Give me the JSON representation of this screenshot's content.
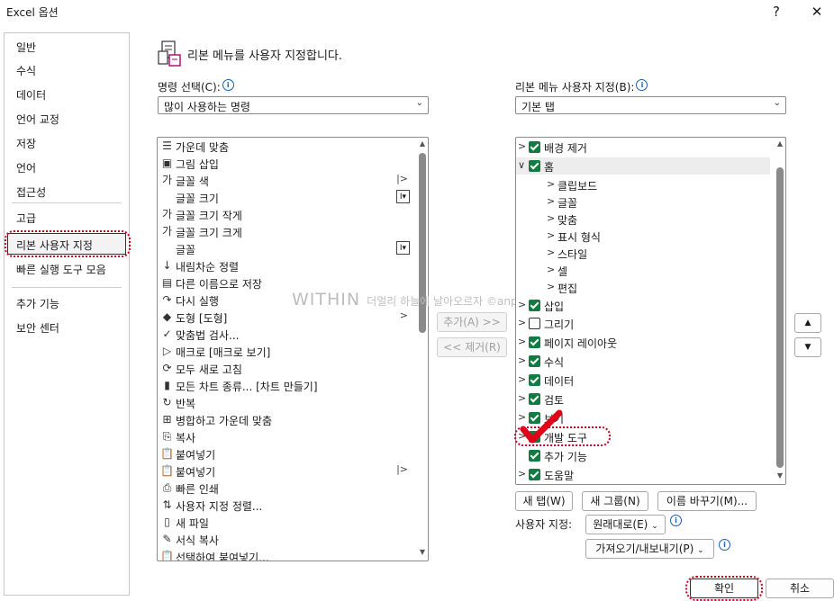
{
  "window": {
    "title": "Excel 옵션",
    "help_glyph": "?",
    "close_glyph": "✕"
  },
  "categories": [
    {
      "label": "일반"
    },
    {
      "label": "수식"
    },
    {
      "label": "데이터"
    },
    {
      "label": "언어 교정"
    },
    {
      "label": "저장"
    },
    {
      "label": "언어"
    },
    {
      "label": "접근성"
    },
    {
      "label": "고급"
    },
    {
      "label": "리본 사용자 지정"
    },
    {
      "label": "빠른 실행 도구 모음"
    },
    {
      "label": "추가 기능"
    },
    {
      "label": "보안 센터"
    }
  ],
  "heading": "리본 메뉴를 사용자 지정합니다.",
  "left": {
    "label": "명령 선택(C):",
    "dropdown_value": "많이 사용하는 명령",
    "commands": [
      {
        "icon": "☰",
        "label": "가운데 맞춤"
      },
      {
        "icon": "▣",
        "label": "그림 삽입"
      },
      {
        "icon": "가",
        "label": "글꼴 색",
        "sub": "|>"
      },
      {
        "icon": "",
        "label": "글꼴 크기",
        "box": "I▾"
      },
      {
        "icon": "가",
        "label": "글꼴 크기 작게"
      },
      {
        "icon": "가",
        "label": "글꼴 크기 크게"
      },
      {
        "icon": "",
        "label": "글꼴",
        "box": "I▾"
      },
      {
        "icon": "↓",
        "label": "내림차순 정렬"
      },
      {
        "icon": "▤",
        "label": "다른 이름으로 저장"
      },
      {
        "icon": "↷",
        "label": "다시 실행"
      },
      {
        "icon": "◆",
        "label": "도형 [도형]",
        "sub": ">"
      },
      {
        "icon": "✓",
        "label": "맞춤법 검사..."
      },
      {
        "icon": "▷",
        "label": "매크로 [매크로 보기]"
      },
      {
        "icon": "⟳",
        "label": "모두 새로 고침"
      },
      {
        "icon": "▮",
        "label": "모든 차트 종류... [차트 만들기]"
      },
      {
        "icon": "↻",
        "label": "반복"
      },
      {
        "icon": "⊞",
        "label": "병합하고 가운데 맞춤"
      },
      {
        "icon": "⎘",
        "label": "복사"
      },
      {
        "icon": "📋",
        "label": "붙여넣기"
      },
      {
        "icon": "📋",
        "label": "붙여넣기",
        "sub": "|>"
      },
      {
        "icon": "⎙",
        "label": "빠른 인쇄"
      },
      {
        "icon": "⇅",
        "label": "사용자 지정 정렬..."
      },
      {
        "icon": "▯",
        "label": "새 파일"
      },
      {
        "icon": "✎",
        "label": "서식 복사"
      },
      {
        "icon": "📋",
        "label": "선택하여 붙여넣기..."
      }
    ]
  },
  "middle": {
    "add_label": "추가(A) >>",
    "remove_label": "<< 제거(R)"
  },
  "right": {
    "label": "리본 메뉴 사용자 지정(B):",
    "dropdown_value": "기본 탭",
    "tabs": [
      {
        "chev": ">",
        "checked": true,
        "label": "배경 제거",
        "level": 0
      },
      {
        "chev": "∨",
        "checked": true,
        "label": "홈",
        "level": 0,
        "selected": true
      },
      {
        "chev": ">",
        "label": "클립보드",
        "level": 1
      },
      {
        "chev": ">",
        "label": "글꼴",
        "level": 1
      },
      {
        "chev": ">",
        "label": "맞춤",
        "level": 1
      },
      {
        "chev": ">",
        "label": "표시 형식",
        "level": 1
      },
      {
        "chev": ">",
        "label": "스타일",
        "level": 1
      },
      {
        "chev": ">",
        "label": "셀",
        "level": 1
      },
      {
        "chev": ">",
        "label": "편집",
        "level": 1
      },
      {
        "chev": ">",
        "checked": true,
        "label": "삽입",
        "level": 0
      },
      {
        "chev": ">",
        "checked": false,
        "label": "그리기",
        "level": 0
      },
      {
        "chev": ">",
        "checked": true,
        "label": "페이지 레이아웃",
        "level": 0
      },
      {
        "chev": ">",
        "checked": true,
        "label": "수식",
        "level": 0
      },
      {
        "chev": ">",
        "checked": true,
        "label": "데이터",
        "level": 0
      },
      {
        "chev": ">",
        "checked": true,
        "label": "검토",
        "level": 0
      },
      {
        "chev": ">",
        "checked": true,
        "label": "보기",
        "level": 0
      },
      {
        "chev": ">",
        "checked": true,
        "label": "개발 도구",
        "level": 0
      },
      {
        "chev": "",
        "checked": true,
        "label": "추가 기능",
        "level": 0
      },
      {
        "chev": ">",
        "checked": true,
        "label": "도움말",
        "level": 0
      }
    ],
    "new_tab": "새 탭(W)",
    "new_group": "새 그룹(N)",
    "rename": "이름 바꾸기(M)...",
    "custom_label": "사용자 지정:",
    "reset_label": "원래대로(E)",
    "import_export_label": "가져오기/내보내기(P)"
  },
  "footer": {
    "ok_label": "확인",
    "cancel_label": "취소"
  },
  "watermark": {
    "brand": "WITHIN",
    "text": "더멀리 하늘에 날아오르자 ©anpo"
  },
  "colors": {
    "checkbox_green": "#107c41",
    "highlight_red": "#d0001e"
  }
}
